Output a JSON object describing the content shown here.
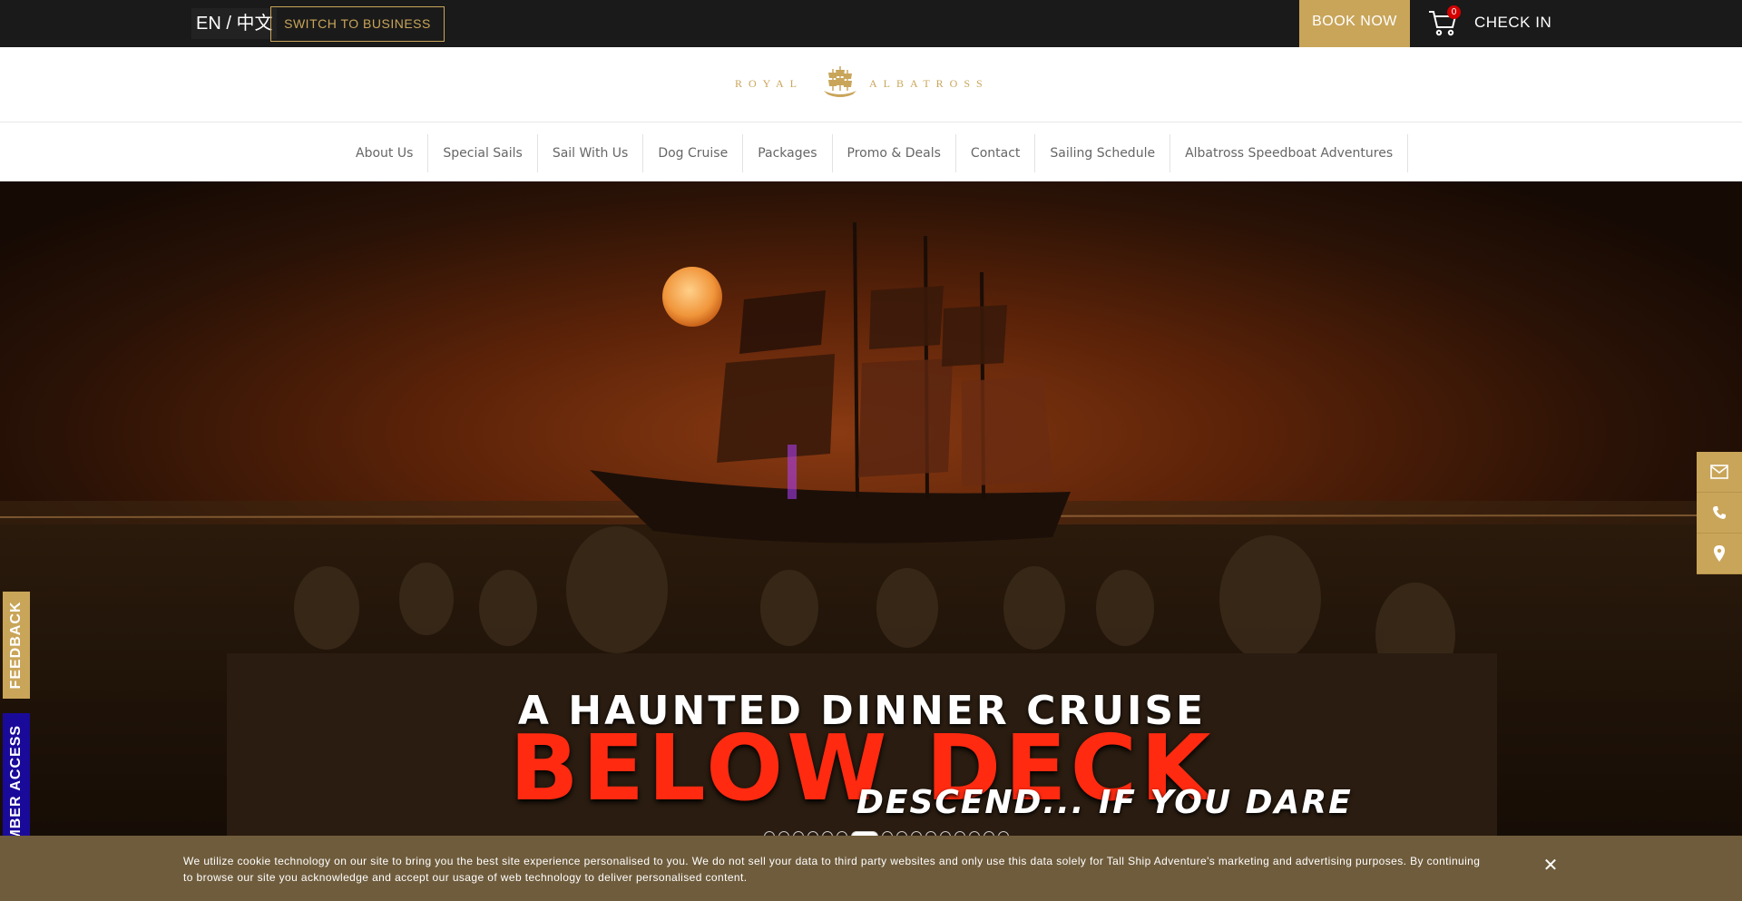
{
  "topbar": {
    "language": "EN / 中文",
    "switch_label": "SWITCH TO BUSINESS",
    "book_label": "BOOK NOW",
    "cart_count": "0",
    "checkin_label": "CHECK IN"
  },
  "logo": {
    "left_text": "ROYAL",
    "right_text": "ALBATROSS"
  },
  "nav": {
    "items": [
      "About Us",
      "Special Sails",
      "Sail With Us",
      "Dog Cruise",
      "Packages",
      "Promo & Deals",
      "Contact",
      "Sailing Schedule",
      "Albatross Speedboat Adventures"
    ]
  },
  "hero": {
    "line1": "A HAUNTED DINNER CRUISE",
    "line2": "BELOW DECK",
    "line3": "DESCEND... IF YOU DARE",
    "slide_count": 16,
    "active_slide": 6
  },
  "side_tabs": {
    "feedback": "FEEDBACK",
    "member": "OC MEMBER ACCESS"
  },
  "contact_icons": [
    "envelope-icon",
    "phone-icon",
    "map-pin-icon"
  ],
  "colors": {
    "gold": "#c9a55a",
    "topbar": "#1a1a1a",
    "member_blue": "#1a0a9a",
    "cookie_bar": "#6f5c3c",
    "title_red": "#ff2a10"
  },
  "cookie": {
    "text": "We utilize cookie technology on our site to bring you the best site experience personalised to you. We do not sell your data to third party websites and only use this data solely for Tall Ship Adventure's marketing and advertising purposes. By continuing to browse our site you acknowledge and accept our usage of web technology to deliver personalised content.",
    "close": "✕"
  }
}
